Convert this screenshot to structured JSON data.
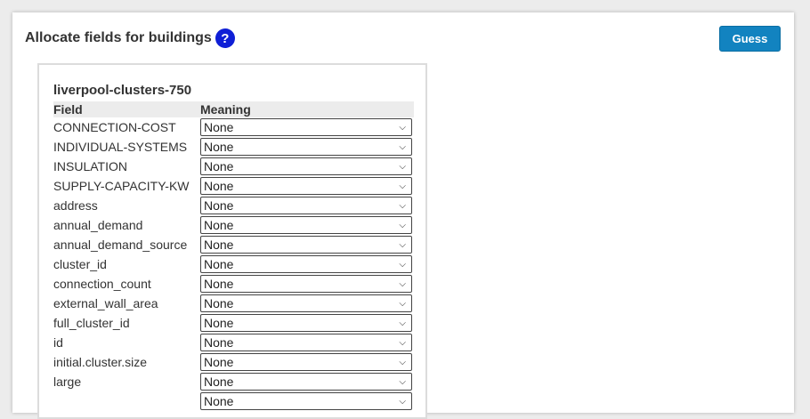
{
  "header": {
    "title": "Allocate fields for buildings",
    "help_glyph": "?",
    "guess_label": "Guess"
  },
  "card": {
    "title": "liverpool-clusters-750",
    "col_field": "Field",
    "col_meaning": "Meaning"
  },
  "rows": [
    {
      "field": "CONNECTION-COST",
      "meaning": "None"
    },
    {
      "field": "INDIVIDUAL-SYSTEMS",
      "meaning": "None"
    },
    {
      "field": "INSULATION",
      "meaning": "None"
    },
    {
      "field": "SUPPLY-CAPACITY-KW",
      "meaning": "None"
    },
    {
      "field": "address",
      "meaning": "None"
    },
    {
      "field": "annual_demand",
      "meaning": "None"
    },
    {
      "field": "annual_demand_source",
      "meaning": "None"
    },
    {
      "field": "cluster_id",
      "meaning": "None"
    },
    {
      "field": "connection_count",
      "meaning": "None"
    },
    {
      "field": "external_wall_area",
      "meaning": "None"
    },
    {
      "field": "full_cluster_id",
      "meaning": "None"
    },
    {
      "field": "id",
      "meaning": "None"
    },
    {
      "field": "initial.cluster.size",
      "meaning": "None"
    },
    {
      "field": "large",
      "meaning": "None"
    },
    {
      "field": "",
      "meaning": "None"
    }
  ],
  "colors": {
    "accent": "#1283c0",
    "help": "#0f1fd6"
  },
  "icons": {
    "help": "help-icon",
    "dropdown": "chevron-down-icon"
  }
}
